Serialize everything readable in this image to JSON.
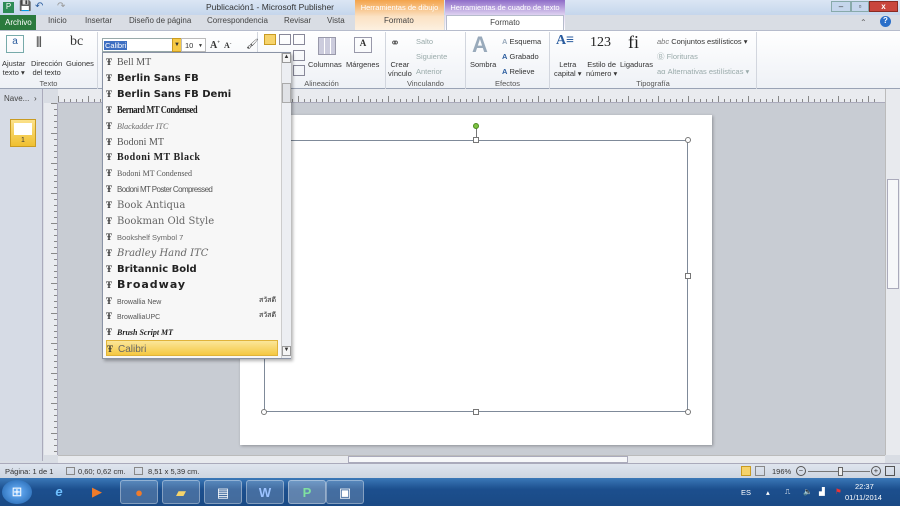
{
  "window": {
    "title": "Publicación1  -  Microsoft Publisher",
    "min": "–",
    "max": "▫",
    "close": "x"
  },
  "context_tabs": {
    "drawing": "Herramientas de dibujo",
    "textbox": "Herramientas de cuadro de texto"
  },
  "tabs": [
    "Archivo",
    "Inicio",
    "Insertar",
    "Diseño de página",
    "Correspondencia",
    "Revisar",
    "Vista",
    "Formato",
    "Formato"
  ],
  "ribbon": {
    "texto": {
      "label": "Texto",
      "ajustar": "Ajustar",
      "ajustar2": "texto ▾",
      "direccion": "Dirección",
      "direccion2": "del texto",
      "guiones": "Guiones"
    },
    "font": {
      "name": "Calibri",
      "size": "10"
    },
    "alineacion": {
      "label": "Alineación",
      "columnas": "Columnas",
      "margenes": "Márgenes"
    },
    "vinculando": {
      "label": "Vinculando",
      "crear": "Crear",
      "crear2": "vínculo",
      "salto": "Salto",
      "siguiente": "Siguiente",
      "anterior": "Anterior"
    },
    "efectos": {
      "label": "Efectos",
      "sombra": "Sombra",
      "esquema": "Esquema",
      "grabado": "Grabado",
      "relieve": "Relieve"
    },
    "tipografia": {
      "label": "Tipografía",
      "letra": "Letra",
      "letra2": "capital ▾",
      "estilo": "Estilo de",
      "estilo2": "número ▾",
      "ligaduras": "Ligaduras",
      "conjuntos": "Conjuntos estilísticos ▾",
      "florituras": "Florituras",
      "alternativas": "Alternativas estilísticas ▾"
    }
  },
  "fonts": [
    {
      "name": "Bell MT"
    },
    {
      "name": "Berlin Sans FB"
    },
    {
      "name": "Berlin Sans FB Demi"
    },
    {
      "name": "Bernard MT Condensed"
    },
    {
      "name": "Blackadder ITC"
    },
    {
      "name": "Bodoni MT"
    },
    {
      "name": "Bodoni MT Black"
    },
    {
      "name": "Bodoni MT Condensed"
    },
    {
      "name": "Bodoni MT Poster Compressed"
    },
    {
      "name": "Book Antiqua"
    },
    {
      "name": "Bookman Old Style"
    },
    {
      "name": "Bookshelf Symbol 7"
    },
    {
      "name": "Bradley Hand ITC"
    },
    {
      "name": "Britannic Bold"
    },
    {
      "name": "Broadway"
    },
    {
      "name": "Browallia New",
      "sample": "สวัสดี"
    },
    {
      "name": "BrowalliaUPC",
      "sample": "สวัสดี"
    },
    {
      "name": "Brush Script MT"
    },
    {
      "name": "Calibri",
      "selected": true
    }
  ],
  "nav": {
    "label": "Nave...",
    "page": "1"
  },
  "status": {
    "page": "Página: 1 de 1",
    "position": "0,60; 0,62 cm.",
    "size": "8,51 x 5,39 cm.",
    "zoom": "196%"
  },
  "taskbar": {
    "lang": "ES",
    "time": "22:37",
    "date": "01/11/2014"
  }
}
